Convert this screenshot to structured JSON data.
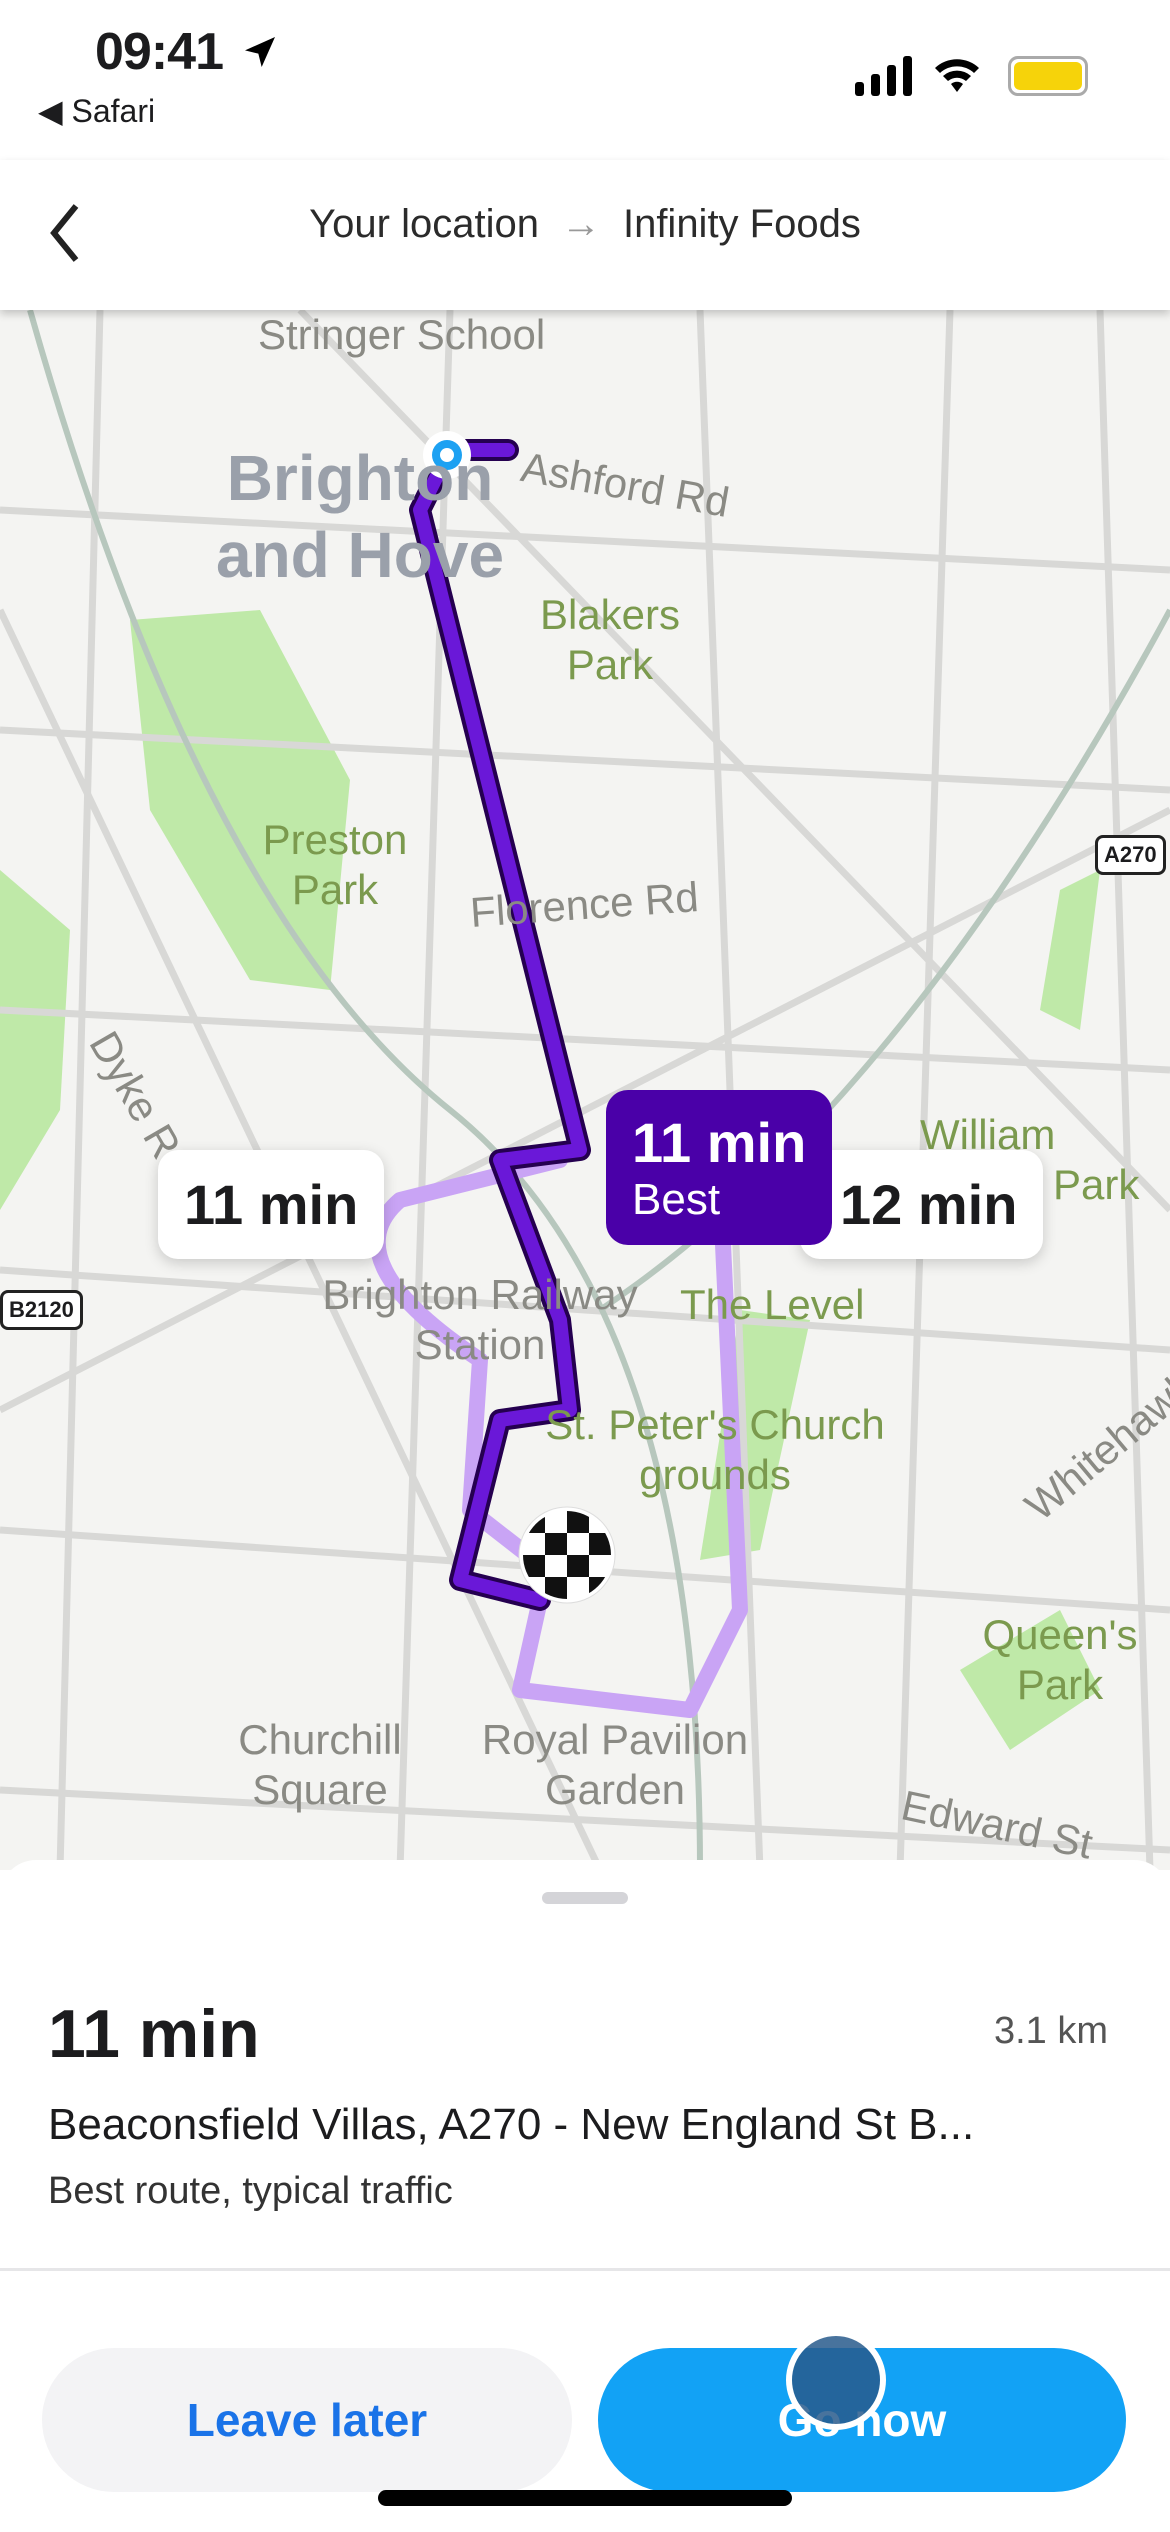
{
  "status_bar": {
    "time": "09:41",
    "back_app": "Safari",
    "battery_color": "#f6d30a"
  },
  "header": {
    "origin": "Your location",
    "arrow": "→",
    "destination": "Infinity Foods"
  },
  "map": {
    "place_labels": [
      {
        "text": "Stringer School",
        "style": "grey"
      },
      {
        "text": "Brighton and Hove",
        "style": "city"
      },
      {
        "text": "Ashford Rd",
        "style": "grey"
      },
      {
        "text": "Blakers Park",
        "style": "green"
      },
      {
        "text": "Preston Park",
        "style": "green"
      },
      {
        "text": "Florence Rd",
        "style": "grey"
      },
      {
        "text": "Dyke Rd",
        "style": "grey"
      },
      {
        "text": "William Clarke Park",
        "style": "green"
      },
      {
        "text": "Brighton Railway Station",
        "style": "grey"
      },
      {
        "text": "The Level",
        "style": "green"
      },
      {
        "text": "St. Peter's Church grounds",
        "style": "green"
      },
      {
        "text": "Whitehawk Rd",
        "style": "grey"
      },
      {
        "text": "Queen's Park",
        "style": "green"
      },
      {
        "text": "Churchill Square",
        "style": "grey"
      },
      {
        "text": "Royal Pavilion Garden",
        "style": "grey"
      },
      {
        "text": "Edward St",
        "style": "grey"
      }
    ],
    "road_shields": [
      "A270",
      "B2120"
    ],
    "route_bubbles": [
      {
        "time": "11 min",
        "tag": "",
        "selected": false
      },
      {
        "time": "11 min",
        "tag": "Best",
        "selected": true
      },
      {
        "time": "12 min",
        "tag": "",
        "selected": false
      }
    ],
    "best_color": "#4a00a8",
    "alt_color": "#c9a4f5"
  },
  "sheet": {
    "eta": "11 min",
    "distance": "3.1 km",
    "via": "Beaconsfield Villas, A270 - New England St B...",
    "note": "Best route, typical traffic",
    "leave_later": "Leave later",
    "go_now": "Go now"
  }
}
